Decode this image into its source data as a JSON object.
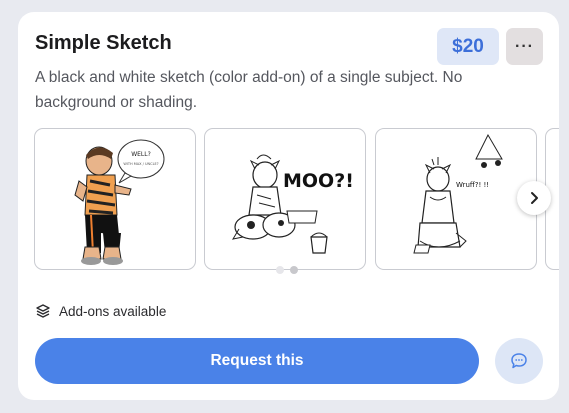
{
  "title": "Simple Sketch",
  "price": "$20",
  "more_label": "···",
  "description": "A black and white sketch (color add-on) of a single subject. No background or shading.",
  "gallery": {
    "bubble_1": "WELL?",
    "bubble_1_small": "WITH MAX / UNCLE?",
    "moo_text": "MOO?!",
    "wruff_text": "Wruff?! !!",
    "current_slide": 1,
    "total_slides": 2
  },
  "addons_label": "Add-ons available",
  "request_label": "Request this",
  "icons": {
    "more": "more-horizontal-icon",
    "next": "chevron-right-icon",
    "addons": "layers-icon",
    "chat": "chat-bubble-icon"
  },
  "colors": {
    "accent": "#4a82e8",
    "price_bg": "#dfe7f7",
    "price_text": "#3d6fd9",
    "page_bg": "#e8eaf0"
  }
}
